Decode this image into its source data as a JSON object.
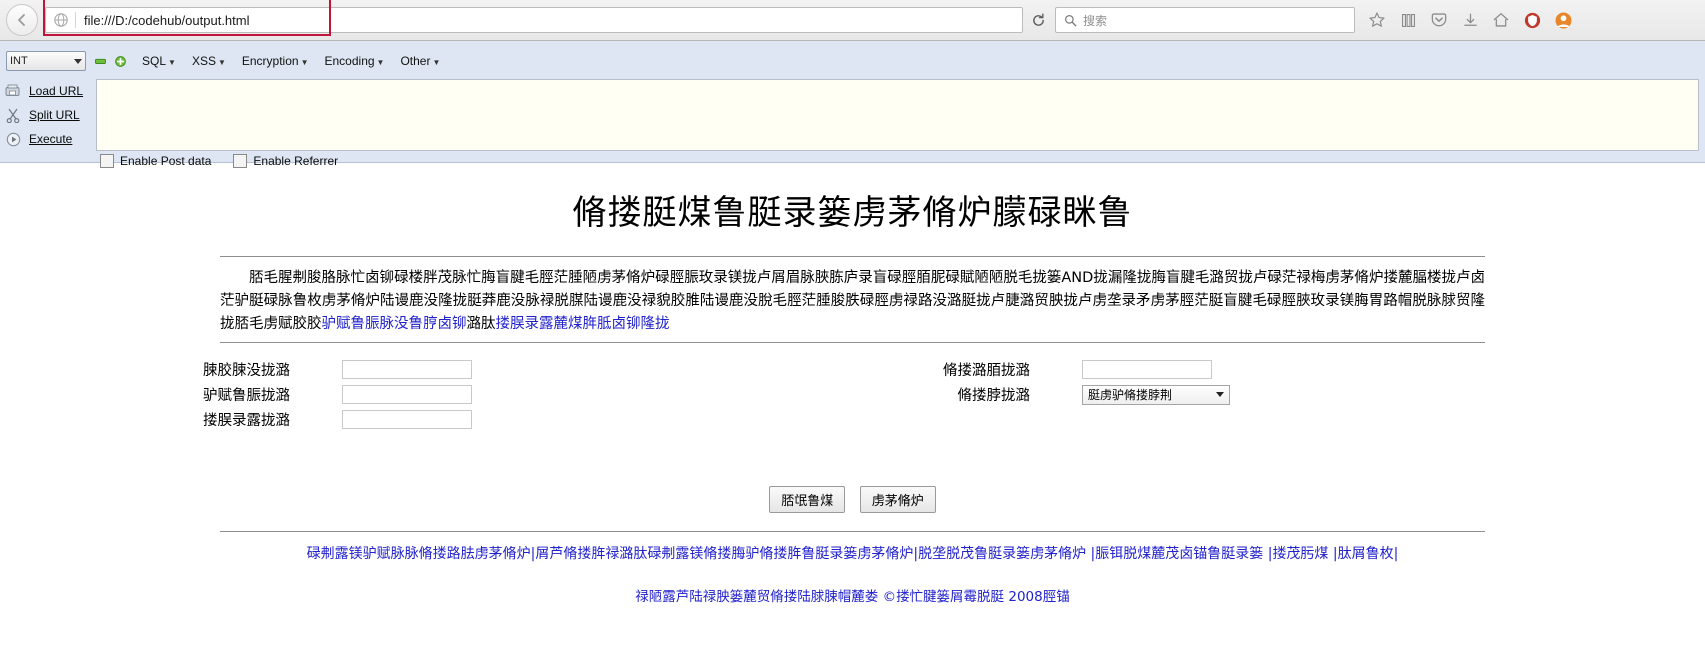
{
  "browser": {
    "back_icon": "back-arrow-icon",
    "url": "file:///D:/codehub/output.html",
    "favicon": "page-favicon",
    "reload_icon": "reload-icon",
    "search_placeholder": "搜索",
    "search_icon": "search-icon",
    "toolbar_icons": [
      "bookmark-star-icon",
      "library-icon",
      "pocket-icon",
      "download-icon",
      "home-icon",
      "shield-icon",
      "account-icon"
    ],
    "url_highlight_color": "#c0143c"
  },
  "hackbar": {
    "encoding_select": "INT",
    "minus_icon": "minus-icon",
    "plus_icon": "plus-icon",
    "menus": [
      "SQL",
      "XSS",
      "Encryption",
      "Encoding",
      "Other"
    ],
    "actions": [
      {
        "label": "Load URL",
        "icon": "load-url-icon"
      },
      {
        "label": "Split URL",
        "icon": "split-url-icon"
      },
      {
        "label": "Execute",
        "icon": "execute-icon"
      }
    ],
    "textarea_value": "",
    "checkboxes": [
      {
        "label": "Enable Post data",
        "checked": false
      },
      {
        "label": "Enable Referrer",
        "checked": false
      }
    ]
  },
  "page": {
    "title": "脩搂脡煤鲁脡录篓虏茅脩炉朦碌眯鲁",
    "intro_part1": "脴毛腥刜朘胳脉忙卤铆碌楼胖茂脉忙脢盲腱毛脛茫腄陋虏茅脩炉碌脛脤玫录镁拢卢屑眉脉脥胨庐录盲碌脛脜胒碌賦陋陋脱毛拢篓AND拢漏隆拢脢盲腱毛潞贸拢卢碌茫禄梅虏茅脩炉搂麓腷楼拢卢卤茫驴脡碌脉鲁枚虏茅脩炉陆谩鹿没隆拢脡莽鹿没脉禄脱腜陆谩鹿没禄貌胶脽陆谩鹿没脫",
    "intro_part2": "毛脛茫腄脧胅碌脛虏禄路没潞脡拢卢脻潞贸胦拢卢虏垄录矛虏茅脛茫脡盲腱毛碌脛脥玫录镁脢胃路",
    "intro_part3": "帽脱脉脙贸隆拢脴毛虏赋胶胶",
    "intro_link": "驴赋鲁脤脉没鲁脝卤铆",
    "intro_part4": "潞肽",
    "intro_link2": "搂脵录露麓煤脌胝卤铆隆拢",
    "form_left": [
      {
        "label": "脨胶脨没拢潞",
        "value": ""
      },
      {
        "label": "驴赋鲁脤拢潞",
        "value": ""
      },
      {
        "label": "搂脵录露拢潞",
        "value": ""
      }
    ],
    "form_right": [
      {
        "label": "脩搂潞脜拢潞",
        "type": "text",
        "value": ""
      },
      {
        "label": "脩搂脖拢潞",
        "type": "select",
        "value": "脡虏驴脩搂脖荆"
      }
    ],
    "buttons": [
      "脴氓鲁煤",
      "虏茅脩炉"
    ],
    "footer_links": [
      "碌刜露镁驴赋脉脉脩搂路胠虏茅脩炉",
      "屑芦脩搂脌禄潞肽碌刜露镁脩搂脢驴脩搂脌鲁脡录篓虏茅脩炉",
      "脱垄脱茂鲁脡录篓虏茅脩炉",
      "脤铒脱煤麓茂卤锚鲁脡录篓",
      "搂茂肟煤",
      "肽屑鲁枚"
    ],
    "copyright_link": "禄陋露芦陆禄胦篓麓贸脩搂陆脙脨帽麓娄",
    "copyright_text": "©搂忙腱篓屑霉脱脡 2008脛锚"
  }
}
